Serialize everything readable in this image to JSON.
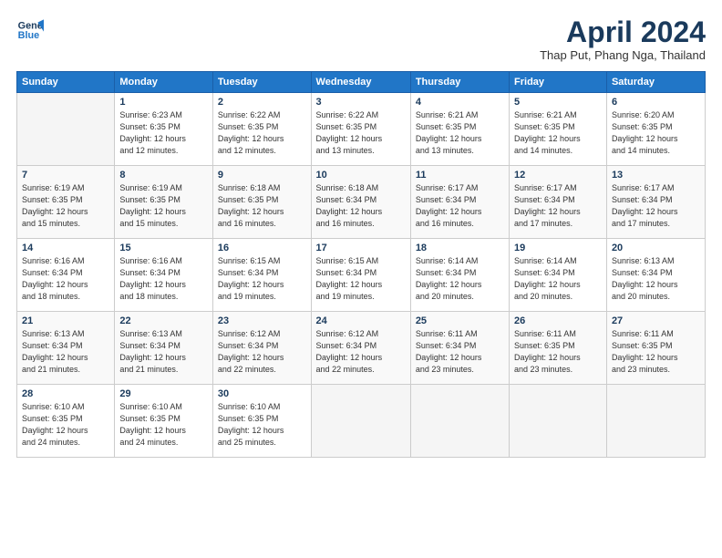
{
  "logo": {
    "line1": "General",
    "line2": "Blue"
  },
  "title": "April 2024",
  "subtitle": "Thap Put, Phang Nga, Thailand",
  "days_of_week": [
    "Sunday",
    "Monday",
    "Tuesday",
    "Wednesday",
    "Thursday",
    "Friday",
    "Saturday"
  ],
  "weeks": [
    [
      {
        "num": "",
        "detail": ""
      },
      {
        "num": "1",
        "detail": "Sunrise: 6:23 AM\nSunset: 6:35 PM\nDaylight: 12 hours\nand 12 minutes."
      },
      {
        "num": "2",
        "detail": "Sunrise: 6:22 AM\nSunset: 6:35 PM\nDaylight: 12 hours\nand 12 minutes."
      },
      {
        "num": "3",
        "detail": "Sunrise: 6:22 AM\nSunset: 6:35 PM\nDaylight: 12 hours\nand 13 minutes."
      },
      {
        "num": "4",
        "detail": "Sunrise: 6:21 AM\nSunset: 6:35 PM\nDaylight: 12 hours\nand 13 minutes."
      },
      {
        "num": "5",
        "detail": "Sunrise: 6:21 AM\nSunset: 6:35 PM\nDaylight: 12 hours\nand 14 minutes."
      },
      {
        "num": "6",
        "detail": "Sunrise: 6:20 AM\nSunset: 6:35 PM\nDaylight: 12 hours\nand 14 minutes."
      }
    ],
    [
      {
        "num": "7",
        "detail": "Sunrise: 6:19 AM\nSunset: 6:35 PM\nDaylight: 12 hours\nand 15 minutes."
      },
      {
        "num": "8",
        "detail": "Sunrise: 6:19 AM\nSunset: 6:35 PM\nDaylight: 12 hours\nand 15 minutes."
      },
      {
        "num": "9",
        "detail": "Sunrise: 6:18 AM\nSunset: 6:35 PM\nDaylight: 12 hours\nand 16 minutes."
      },
      {
        "num": "10",
        "detail": "Sunrise: 6:18 AM\nSunset: 6:34 PM\nDaylight: 12 hours\nand 16 minutes."
      },
      {
        "num": "11",
        "detail": "Sunrise: 6:17 AM\nSunset: 6:34 PM\nDaylight: 12 hours\nand 16 minutes."
      },
      {
        "num": "12",
        "detail": "Sunrise: 6:17 AM\nSunset: 6:34 PM\nDaylight: 12 hours\nand 17 minutes."
      },
      {
        "num": "13",
        "detail": "Sunrise: 6:17 AM\nSunset: 6:34 PM\nDaylight: 12 hours\nand 17 minutes."
      }
    ],
    [
      {
        "num": "14",
        "detail": "Sunrise: 6:16 AM\nSunset: 6:34 PM\nDaylight: 12 hours\nand 18 minutes."
      },
      {
        "num": "15",
        "detail": "Sunrise: 6:16 AM\nSunset: 6:34 PM\nDaylight: 12 hours\nand 18 minutes."
      },
      {
        "num": "16",
        "detail": "Sunrise: 6:15 AM\nSunset: 6:34 PM\nDaylight: 12 hours\nand 19 minutes."
      },
      {
        "num": "17",
        "detail": "Sunrise: 6:15 AM\nSunset: 6:34 PM\nDaylight: 12 hours\nand 19 minutes."
      },
      {
        "num": "18",
        "detail": "Sunrise: 6:14 AM\nSunset: 6:34 PM\nDaylight: 12 hours\nand 20 minutes."
      },
      {
        "num": "19",
        "detail": "Sunrise: 6:14 AM\nSunset: 6:34 PM\nDaylight: 12 hours\nand 20 minutes."
      },
      {
        "num": "20",
        "detail": "Sunrise: 6:13 AM\nSunset: 6:34 PM\nDaylight: 12 hours\nand 20 minutes."
      }
    ],
    [
      {
        "num": "21",
        "detail": "Sunrise: 6:13 AM\nSunset: 6:34 PM\nDaylight: 12 hours\nand 21 minutes."
      },
      {
        "num": "22",
        "detail": "Sunrise: 6:13 AM\nSunset: 6:34 PM\nDaylight: 12 hours\nand 21 minutes."
      },
      {
        "num": "23",
        "detail": "Sunrise: 6:12 AM\nSunset: 6:34 PM\nDaylight: 12 hours\nand 22 minutes."
      },
      {
        "num": "24",
        "detail": "Sunrise: 6:12 AM\nSunset: 6:34 PM\nDaylight: 12 hours\nand 22 minutes."
      },
      {
        "num": "25",
        "detail": "Sunrise: 6:11 AM\nSunset: 6:34 PM\nDaylight: 12 hours\nand 23 minutes."
      },
      {
        "num": "26",
        "detail": "Sunrise: 6:11 AM\nSunset: 6:35 PM\nDaylight: 12 hours\nand 23 minutes."
      },
      {
        "num": "27",
        "detail": "Sunrise: 6:11 AM\nSunset: 6:35 PM\nDaylight: 12 hours\nand 23 minutes."
      }
    ],
    [
      {
        "num": "28",
        "detail": "Sunrise: 6:10 AM\nSunset: 6:35 PM\nDaylight: 12 hours\nand 24 minutes."
      },
      {
        "num": "29",
        "detail": "Sunrise: 6:10 AM\nSunset: 6:35 PM\nDaylight: 12 hours\nand 24 minutes."
      },
      {
        "num": "30",
        "detail": "Sunrise: 6:10 AM\nSunset: 6:35 PM\nDaylight: 12 hours\nand 25 minutes."
      },
      {
        "num": "",
        "detail": ""
      },
      {
        "num": "",
        "detail": ""
      },
      {
        "num": "",
        "detail": ""
      },
      {
        "num": "",
        "detail": ""
      }
    ]
  ]
}
